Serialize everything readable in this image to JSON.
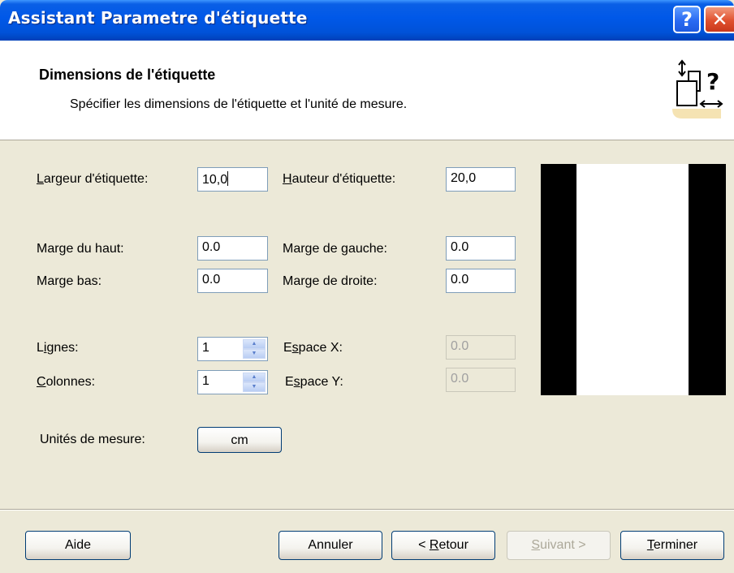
{
  "window": {
    "title": "Assistant Parametre d'étiquette",
    "help_glyph": "?",
    "close_glyph": "✕"
  },
  "header": {
    "title": "Dimensions de l'étiquette",
    "subtitle": "Spécifier les dimensions de l'étiquette et l'unité de mesure.",
    "icon": "label-size-help-icon"
  },
  "form": {
    "width": {
      "label_accel": "L",
      "label_rest": "argeur d'étiquette:",
      "value": "10,0"
    },
    "height": {
      "label_accel": "H",
      "label_rest": "auteur d'étiquette:",
      "value": "20,0"
    },
    "margin_top": {
      "label": "Marge du haut:",
      "value": "0.0"
    },
    "margin_left": {
      "label": "Marge de gauche:",
      "value": "0.0"
    },
    "margin_bottom": {
      "label": "Marge bas:",
      "value": "0.0"
    },
    "margin_right": {
      "label": "Marge de droite:",
      "value": "0.0"
    },
    "rows": {
      "label_pre": "L",
      "label_accel": "i",
      "label_rest": "gnes:",
      "value": "1"
    },
    "columns": {
      "label_accel": "C",
      "label_rest": "olonnes:",
      "value": "1"
    },
    "space_x": {
      "label_pre": "E",
      "label_accel": "s",
      "label_rest": "pace X:",
      "value": "0.0"
    },
    "space_y": {
      "label_pre": "E",
      "label_accel": "s",
      "label_rest": "pace Y:",
      "value": "0.0"
    },
    "units": {
      "label": "Unités de mesure:",
      "value": "cm"
    }
  },
  "buttons": {
    "help": "Aide",
    "cancel": "Annuler",
    "back_pre": "< ",
    "back_accel": "R",
    "back_rest": "etour",
    "next_accel": "S",
    "next_rest": "uivant >",
    "finish_accel": "T",
    "finish_rest": "erminer"
  },
  "colors": {
    "titlebar": "#0058e8",
    "dialog_bg": "#ece9d8",
    "close_button": "#e0502e"
  }
}
